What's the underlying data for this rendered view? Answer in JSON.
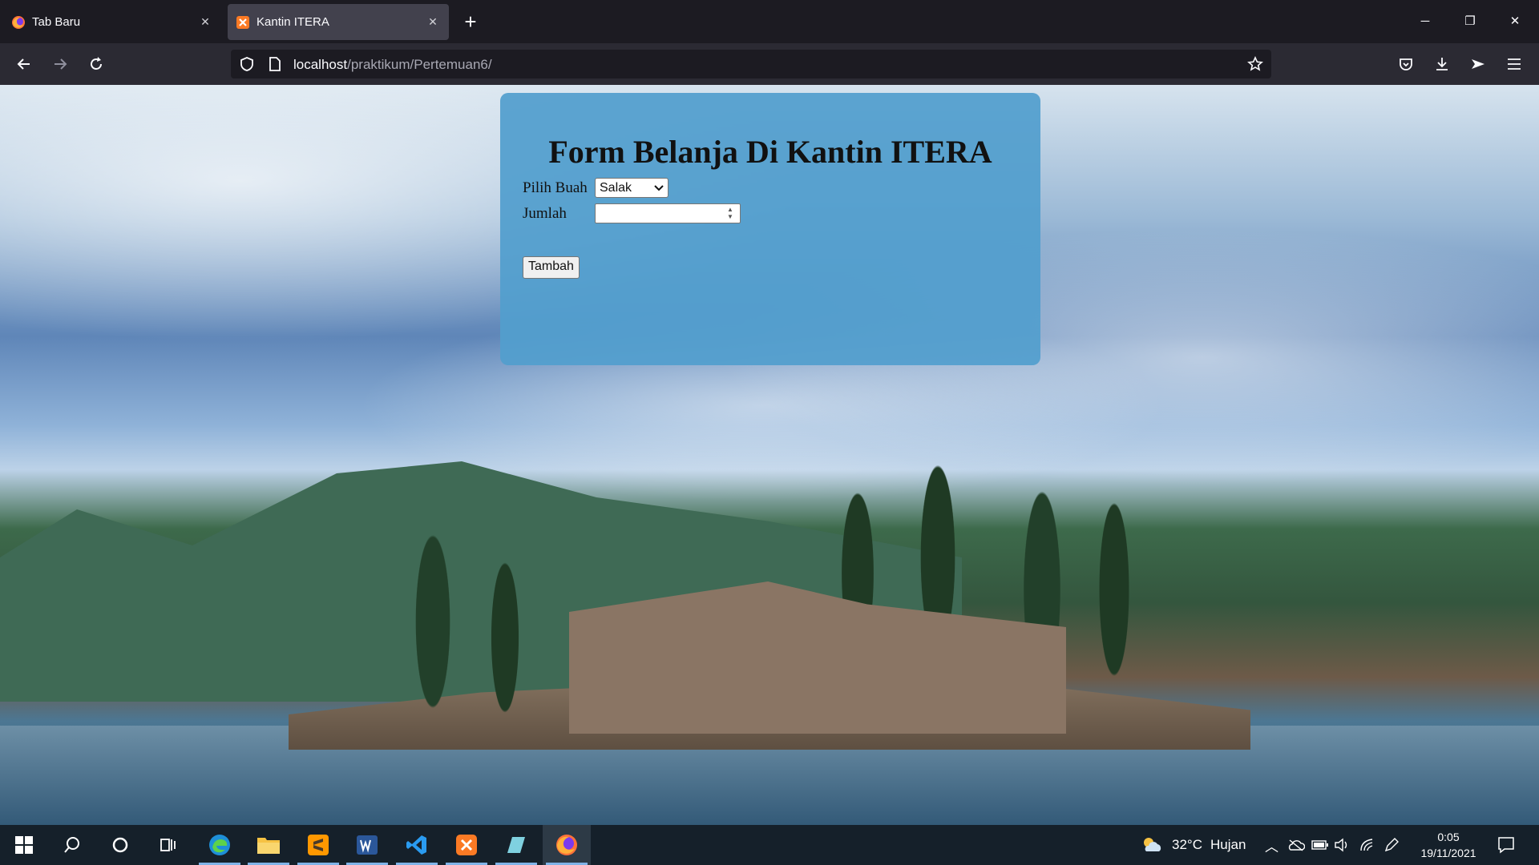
{
  "browser": {
    "tabs": [
      {
        "title": "Tab Baru",
        "icon": "firefox-icon",
        "active": false
      },
      {
        "title": "Kantin ITERA",
        "icon": "xampp-icon",
        "active": true
      }
    ],
    "url": {
      "host": "localhost",
      "path": "/praktikum/Pertemuan6/"
    }
  },
  "form": {
    "title": "Form Belanja Di Kantin ITERA",
    "fruit_label": "Pilih Buah",
    "fruit_selected": "Salak",
    "qty_label": "Jumlah",
    "qty_value": "",
    "submit_label": "Tambah",
    "card_color": "#529ece"
  },
  "taskbar": {
    "apps": [
      "windows-start-icon",
      "search-icon",
      "cortana-icon",
      "task-view-icon",
      "edge-icon",
      "file-explorer-icon",
      "sublime-text-icon",
      "word-icon",
      "vscode-icon",
      "xampp-icon",
      "notes-icon",
      "firefox-icon"
    ],
    "weather_temp": "32°C",
    "weather_text": "Hujan",
    "time": "0:05",
    "date": "19/11/2021"
  }
}
